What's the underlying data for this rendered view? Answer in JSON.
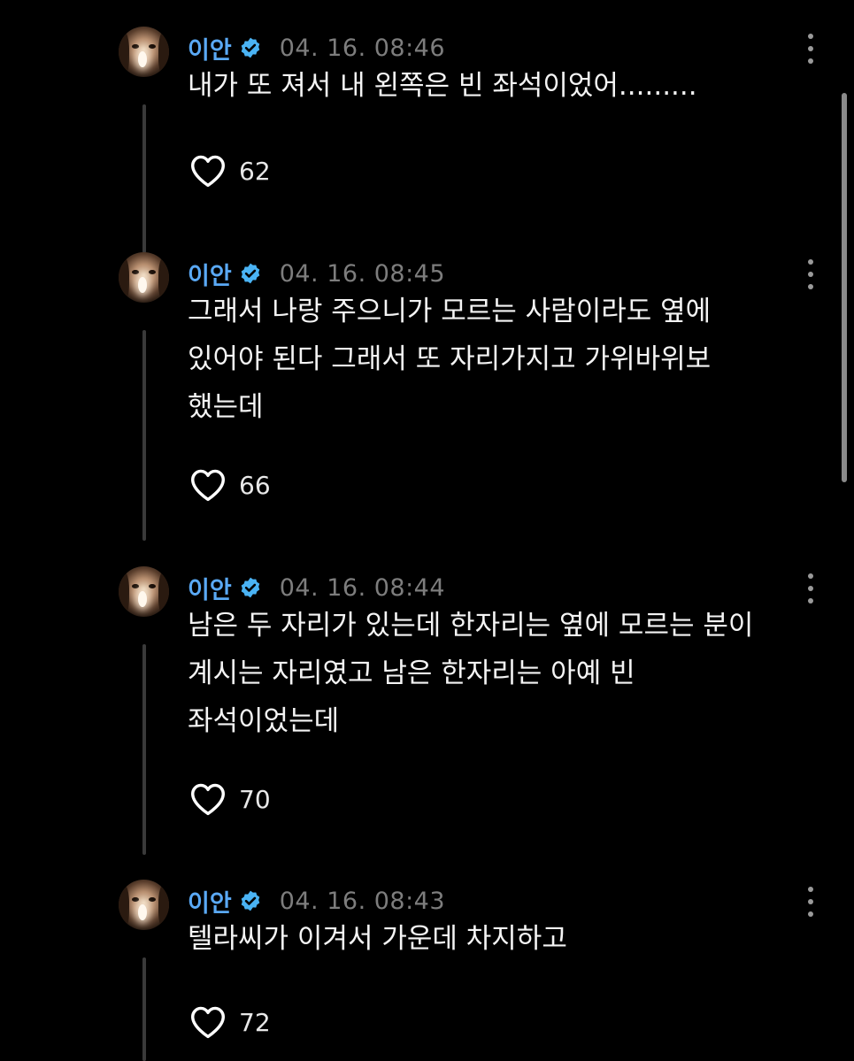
{
  "posts": [
    {
      "username": "이안",
      "timestamp": "04. 16. 08:46",
      "text": "내가 또 져서 내 왼쪽은 빈 좌석이었어.........",
      "likes": "62"
    },
    {
      "username": "이안",
      "timestamp": "04. 16. 08:45",
      "text": "그래서 나랑 주으니가 모르는 사람이라도 옆에\n있어야 된다 그래서 또 자리가지고 가위바위보\n했는데",
      "likes": "66"
    },
    {
      "username": "이안",
      "timestamp": "04. 16. 08:44",
      "text": "남은 두 자리가 있는데 한자리는 옆에 모르는 분이\n계시는 자리였고 남은 한자리는 아예 빈\n좌석이었는데",
      "likes": "70"
    },
    {
      "username": "이안",
      "timestamp": "04. 16. 08:43",
      "text": "텔라씨가 이겨서 가운데 차지하고",
      "likes": "72"
    }
  ],
  "icons": {
    "verified": "verified-badge-icon",
    "like": "heart-icon",
    "more": "more-vertical-icon"
  },
  "colors": {
    "background": "#000000",
    "username": "#5aa9f5",
    "verified_badge": "#4ab3f4",
    "timestamp": "#7d7d7d",
    "text": "#f4f4f4"
  }
}
